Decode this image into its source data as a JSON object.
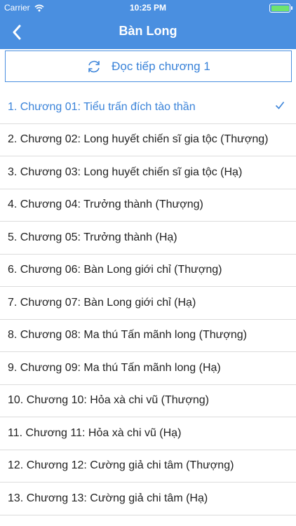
{
  "status_bar": {
    "carrier": "Carrier",
    "time": "10:25 PM",
    "battery_level": 1.0,
    "battery_color": "#6ee36e"
  },
  "nav": {
    "title": "Bàn Long",
    "back_icon": "chevron-left-icon"
  },
  "continue_button": {
    "label": "Đọc tiếp chương 1",
    "icon": "refresh-icon"
  },
  "colors": {
    "accent": "#4a8fe0",
    "selected_text": "#3a83d9",
    "divider": "#dcdcdc"
  },
  "chapters": [
    {
      "label": "1. Chương 01:  Tiểu trấn đích tào thần",
      "selected": true
    },
    {
      "label": "2. Chương 02: Long huyết chiến sĩ gia tộc (Thượng)",
      "selected": false
    },
    {
      "label": "3. Chương 03: Long huyết chiến sĩ gia tộc (Hạ)",
      "selected": false
    },
    {
      "label": "4. Chương 04: Trưởng thành (Thượng)",
      "selected": false
    },
    {
      "label": "5. Chương 05: Trưởng thành (Hạ)",
      "selected": false
    },
    {
      "label": "6. Chương 06: Bàn Long giới chỉ (Thượng)",
      "selected": false
    },
    {
      "label": "7. Chương 07: Bàn Long giới chỉ (Hạ)",
      "selected": false
    },
    {
      "label": "8. Chương 08: Ma thú Tấn mãnh long (Thượng)",
      "selected": false
    },
    {
      "label": "9. Chương 09: Ma thú Tấn mãnh long (Hạ)",
      "selected": false
    },
    {
      "label": "10. Chương 10: Hỏa xà chi vũ (Thượng)",
      "selected": false
    },
    {
      "label": "11. Chương 11: Hỏa xà chi vũ (Hạ)",
      "selected": false
    },
    {
      "label": "12. Chương 12: Cường giả chi tâm (Thượng)",
      "selected": false
    },
    {
      "label": "13. Chương 13: Cường giả chi tâm (Hạ)",
      "selected": false
    }
  ]
}
